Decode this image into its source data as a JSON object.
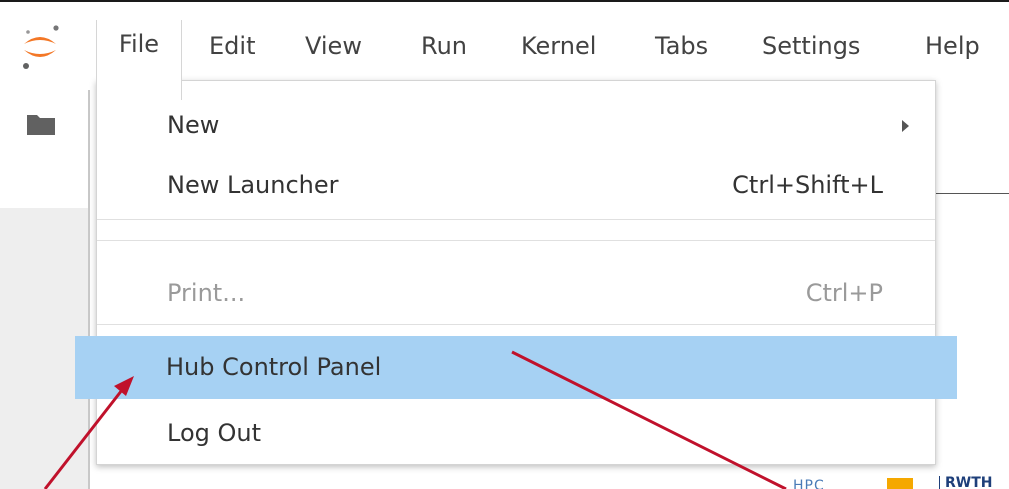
{
  "menubar": {
    "logo": "jupyter-logo",
    "items": [
      {
        "label": "File"
      },
      {
        "label": "Edit"
      },
      {
        "label": "View"
      },
      {
        "label": "Run"
      },
      {
        "label": "Kernel"
      },
      {
        "label": "Tabs"
      },
      {
        "label": "Settings"
      },
      {
        "label": "Help"
      }
    ]
  },
  "sidebar": {
    "icon": "folder-icon"
  },
  "file_menu": {
    "new": {
      "label": "New",
      "submenu_icon": "chevron-right-icon"
    },
    "new_launcher": {
      "label": "New Launcher",
      "shortcut": "Ctrl+Shift+L"
    },
    "print": {
      "label": "Print...",
      "shortcut": "Ctrl+P",
      "disabled": true
    },
    "hub_control_panel": {
      "label": "Hub Control Panel",
      "highlighted": true
    },
    "log_out": {
      "label": "Log Out"
    }
  },
  "footer_logos": {
    "left_text": "HPC",
    "right_text": "RWTH"
  },
  "colors": {
    "highlight": "#a6d1f3",
    "arrow": "#c0112b",
    "logo_orange": "#f37726",
    "sidebar_bg": "#eeeeee"
  }
}
